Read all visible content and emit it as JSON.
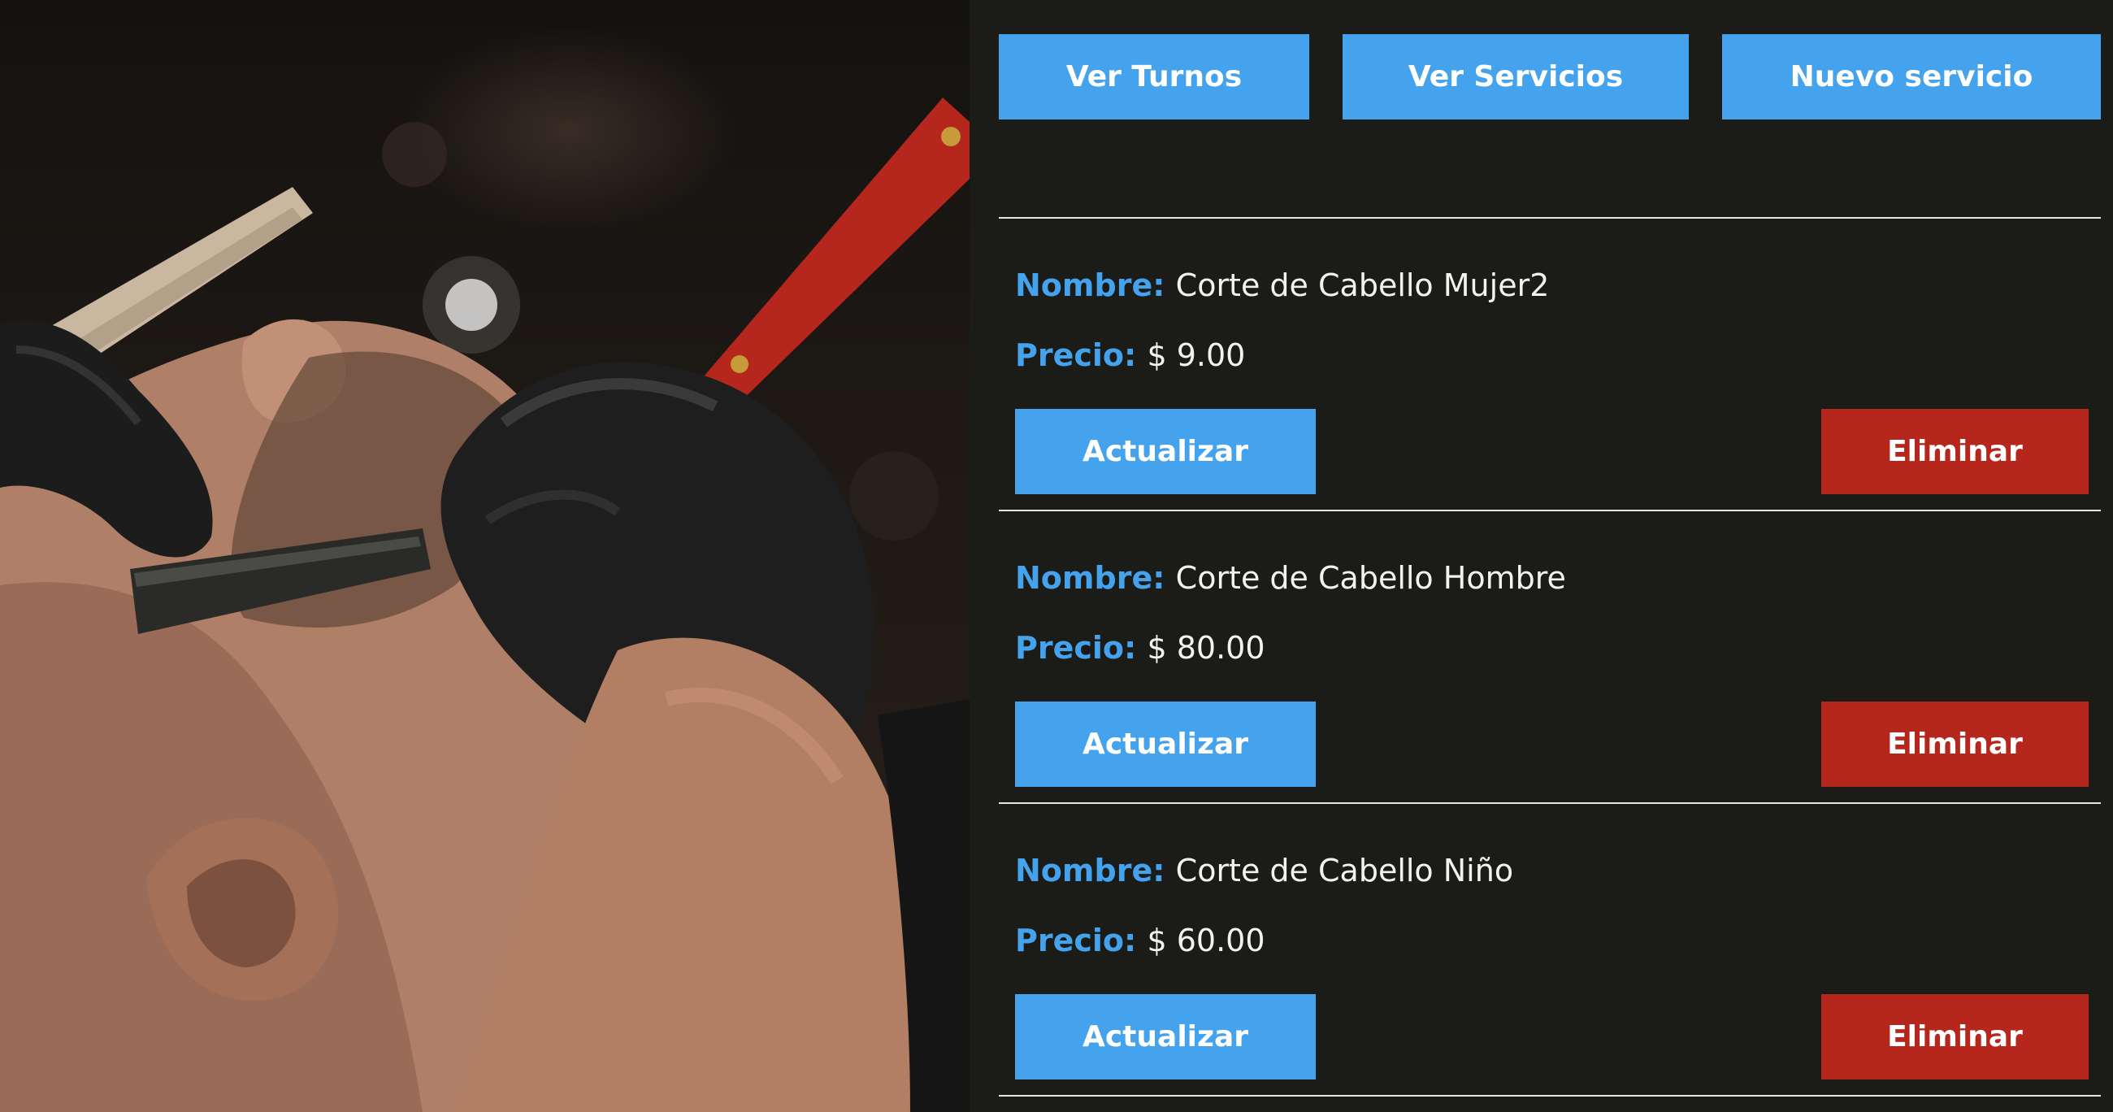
{
  "hero": {
    "image": "barber-shaving-photo"
  },
  "nav": {
    "turnos_label": "Ver Turnos",
    "servicios_label": "Ver Servicios",
    "nuevo_label": "Nuevo servicio"
  },
  "labels": {
    "name": "Nombre:",
    "price": "Precio:",
    "update": "Actualizar",
    "delete": "Eliminar"
  },
  "services": [
    {
      "name": "Corte de Cabello Mujer2",
      "price": "$ 9.00"
    },
    {
      "name": "Corte de Cabello Hombre",
      "price": "$ 80.00"
    },
    {
      "name": "Corte de Cabello Niño",
      "price": "$ 60.00"
    }
  ],
  "colors": {
    "accent": "#44a3ec",
    "danger": "#b5271c",
    "background": "#1b1b18"
  }
}
